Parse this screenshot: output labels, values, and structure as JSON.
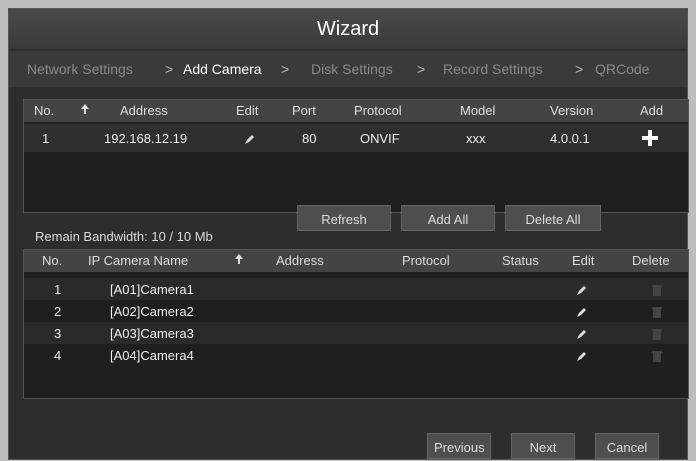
{
  "window": {
    "title": "Wizard"
  },
  "breadcrumb": [
    {
      "label": "Network Settings",
      "active": false
    },
    {
      "label": "Add Camera",
      "active": true
    },
    {
      "label": "Disk Settings",
      "active": false
    },
    {
      "label": "Record Settings",
      "active": false
    },
    {
      "label": "QRCode",
      "active": false
    }
  ],
  "breadcrumb_sep": ">",
  "search_table": {
    "headers": [
      "No.",
      "Address",
      "Edit",
      "Port",
      "Protocol",
      "Model",
      "Version",
      "Add"
    ],
    "rows": [
      {
        "no": "1",
        "address": "192.168.12.19",
        "port": "80",
        "protocol": "ONVIF",
        "model": "xxx",
        "version": "4.0.0.1"
      }
    ]
  },
  "bandwidth": "Remain Bandwidth: 10 / 10 Mb",
  "actions": {
    "refresh": "Refresh",
    "add_all": "Add All",
    "delete_all": "Delete All"
  },
  "added_table": {
    "headers": [
      "No.",
      "IP Camera Name",
      "Address",
      "Protocol",
      "Status",
      "Edit",
      "Delete"
    ],
    "rows": [
      {
        "no": "1",
        "name": "[A01]Camera1"
      },
      {
        "no": "2",
        "name": "[A02]Camera2"
      },
      {
        "no": "3",
        "name": "[A03]Camera3"
      },
      {
        "no": "4",
        "name": "[A04]Camera4"
      }
    ]
  },
  "nav": {
    "previous": "Previous",
    "next": "Next",
    "cancel": "Cancel"
  },
  "colors": {
    "window_bg": "#2d2d2d",
    "header_bg": "#444444",
    "button_bg": "#4e4e4e"
  },
  "icons": {
    "sort": "sort-up-arrow-icon",
    "edit": "pencil-icon",
    "add": "plus-icon",
    "delete": "trash-icon"
  }
}
